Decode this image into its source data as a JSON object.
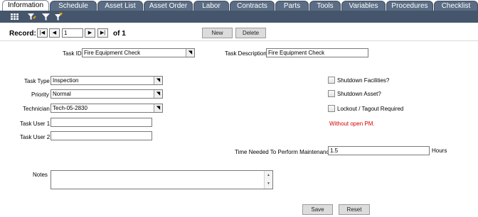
{
  "tabs": [
    {
      "label": "Information",
      "active": true
    },
    {
      "label": "Schedule",
      "active": false
    },
    {
      "label": "Asset List",
      "active": false
    },
    {
      "label": "Asset Order",
      "active": false
    },
    {
      "label": "Labor",
      "active": false
    },
    {
      "label": "Contracts",
      "active": false
    },
    {
      "label": "Parts",
      "active": false
    },
    {
      "label": "Tools",
      "active": false
    },
    {
      "label": "Variables",
      "active": false
    },
    {
      "label": "Procedures",
      "active": false
    },
    {
      "label": "Checklist",
      "active": false
    }
  ],
  "toolbar": {
    "icons": [
      "grid-icon",
      "filter-edit-icon",
      "filter-icon",
      "filter-clear-icon"
    ]
  },
  "record": {
    "label": "Record:",
    "current": "1",
    "of_label": "of 1",
    "first": "|◀",
    "prev": "◀",
    "next": "▶",
    "last": "▶|"
  },
  "buttons": {
    "new": "New",
    "delete": "Delete",
    "save": "Save",
    "reset": "Reset"
  },
  "form": {
    "task_id_label": "Task ID",
    "task_id_value": "Fire Equipment Check",
    "task_description_label": "Task Description",
    "task_description_value": "Fire Equipment Check",
    "task_type_label": "Task Type",
    "task_type_value": "Inspection",
    "priority_label": "Priority",
    "priority_value": "Normal",
    "technician_label": "Technician",
    "technician_value": "Tech-05-2830",
    "task_user1_label": "Task User 1",
    "task_user1_value": "",
    "task_user2_label": "Task User 2",
    "task_user2_value": "",
    "shutdown_facilities_label": "Shutdown Facilities?",
    "shutdown_asset_label": "Shutdown Asset?",
    "lockout_label": "Lockout / Tagout Required",
    "warning_text": "Without open PM.",
    "time_needed_label": "Time Needed To Perform Maintenance",
    "time_needed_value": "1.5",
    "hours_label": "Hours",
    "notes_label": "Notes",
    "notes_value": ""
  },
  "colors": {
    "tab_bg": "#5b6d84",
    "toolbar_bg": "#45566c",
    "warning": "#d40000"
  }
}
